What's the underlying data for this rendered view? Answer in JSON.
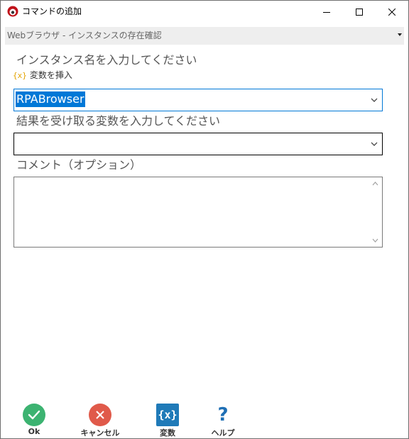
{
  "window": {
    "title": "コマンドの追加",
    "brand_color": "#c0121a"
  },
  "command_selector": {
    "value": "Webブラウザ - インスタンスの存在確認"
  },
  "form": {
    "instance_label": "インスタンス名を入力してください",
    "insert_variable_icon": "{x}",
    "insert_variable_label": "変数を挿入",
    "instance_value": "RPABrowser",
    "result_label": "結果を受け取る変数を入力してください",
    "result_value": "",
    "comment_label": "コメント（オプション）",
    "comment_value": ""
  },
  "footer": {
    "ok_label": "Ok",
    "cancel_label": "キャンセル",
    "variables_label": "変数",
    "variables_icon": "{x}",
    "help_label": "ヘルプ",
    "help_icon": "?",
    "ok_color": "#3cb371",
    "cancel_color": "#e05a4a",
    "variables_color": "#1f7ab8",
    "help_color": "#1f6fb5"
  }
}
